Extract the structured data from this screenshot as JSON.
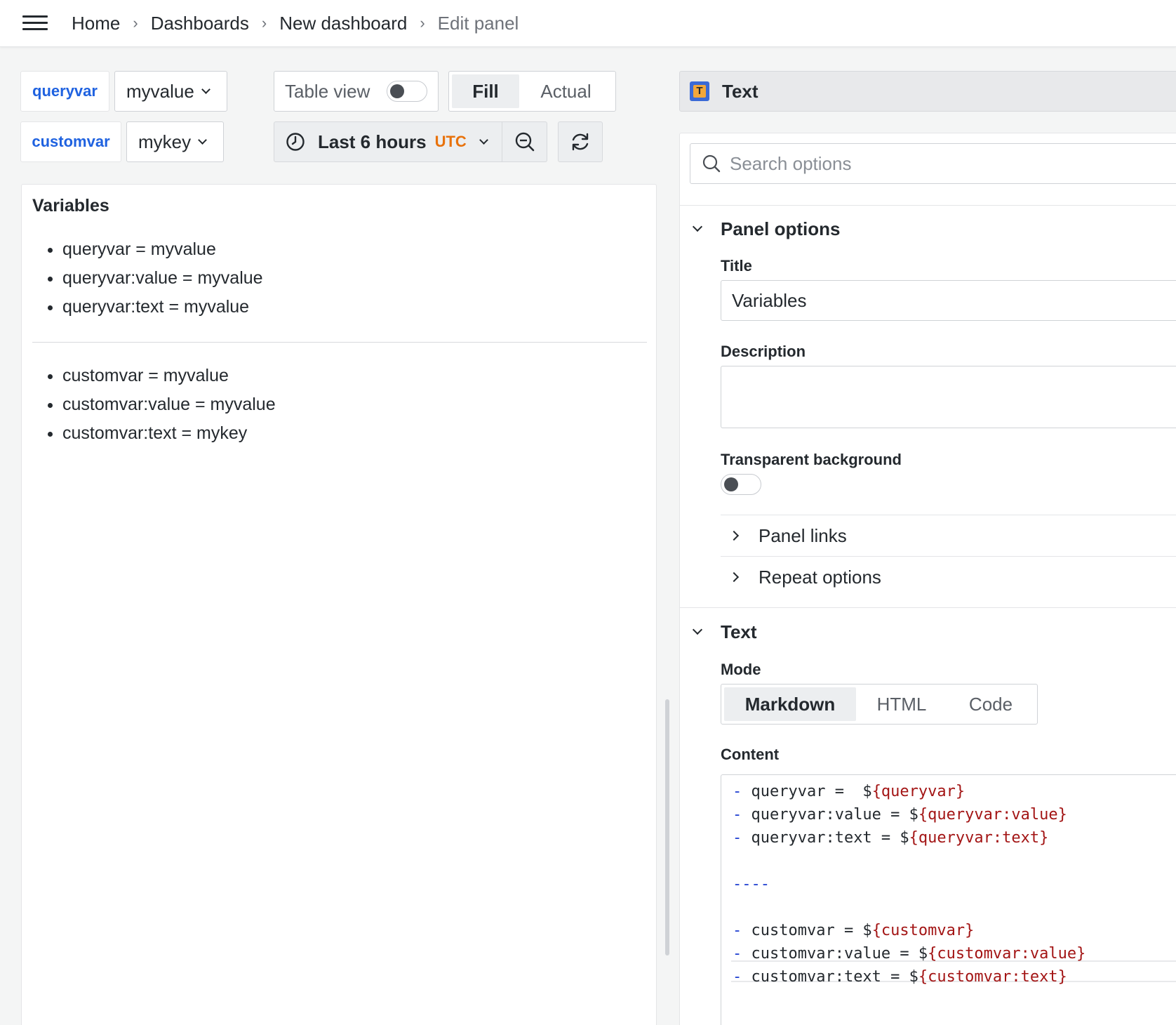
{
  "breadcrumb": [
    "Home",
    "Dashboards",
    "New dashboard",
    "Edit panel"
  ],
  "variables": [
    {
      "name": "queryvar",
      "value": "myvalue"
    },
    {
      "name": "customvar",
      "value": "mykey"
    }
  ],
  "toolbar": {
    "table_view_label": "Table view",
    "table_view_enabled": false,
    "fill_label": "Fill",
    "actual_label": "Actual",
    "time_range": "Last 6 hours",
    "timezone": "UTC"
  },
  "preview": {
    "title": "Variables",
    "list1": [
      "queryvar = myvalue",
      "queryvar:value = myvalue",
      "queryvar:text = myvalue"
    ],
    "list2": [
      "customvar = myvalue",
      "customvar:value = myvalue",
      "customvar:text = mykey"
    ]
  },
  "options": {
    "visualization": "Text",
    "search_placeholder": "Search options",
    "panel_options": {
      "heading": "Panel options",
      "title_label": "Title",
      "title_value": "Variables",
      "description_label": "Description",
      "description_value": "",
      "transparent_label": "Transparent background",
      "transparent_enabled": false,
      "panel_links": "Panel links",
      "repeat_options": "Repeat options"
    },
    "text_section": {
      "heading": "Text",
      "mode_label": "Mode",
      "modes": [
        "Markdown",
        "HTML",
        "Code"
      ],
      "selected_mode": "Markdown",
      "content_label": "Content"
    }
  },
  "content_lines": [
    {
      "dash": "-",
      "text": " queryvar =  $",
      "var": "{queryvar}"
    },
    {
      "dash": "-",
      "text": " queryvar:value = $",
      "var": "{queryvar:value}"
    },
    {
      "dash": "-",
      "text": " queryvar:text = $",
      "var": "{queryvar:text}"
    },
    {
      "dash": "",
      "text": "",
      "var": ""
    },
    {
      "dash": "----",
      "text": "",
      "var": ""
    },
    {
      "dash": "",
      "text": "",
      "var": ""
    },
    {
      "dash": "-",
      "text": " customvar = $",
      "var": "{customvar}"
    },
    {
      "dash": "-",
      "text": " customvar:value = $",
      "var": "{customvar:value}"
    },
    {
      "dash": "-",
      "text": " customvar:text = $",
      "var": "{customvar:text}"
    }
  ],
  "colors": {
    "accent_blue": "#1f62e0",
    "utc_orange": "#e8720c",
    "code_variable": "#a31515",
    "code_dash": "#1f3fd1"
  }
}
